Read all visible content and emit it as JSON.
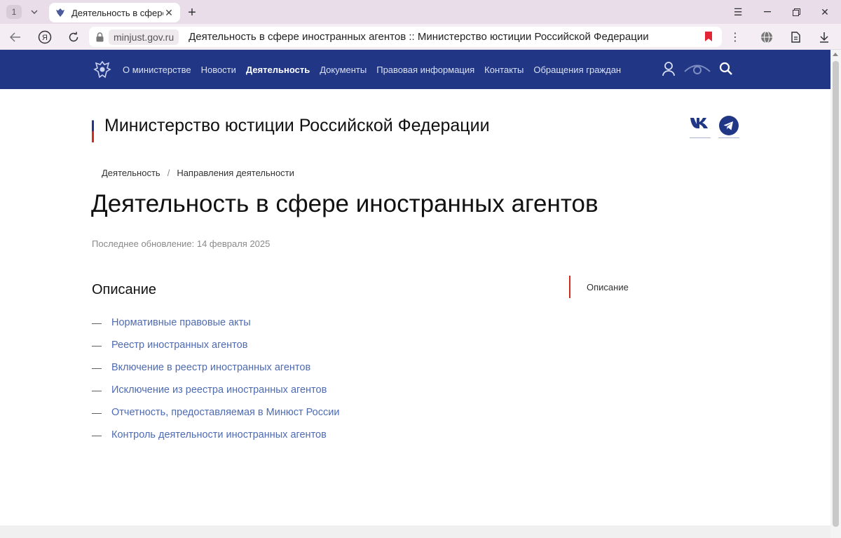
{
  "browser": {
    "tab_count": "1",
    "tab_title": "Деятельность в сфере",
    "domain": "minjust.gov.ru",
    "page_title": "Деятельность в сфере иностранных агентов :: Министерство юстиции Российской Федерации",
    "bookmark_color": "#e32636"
  },
  "site_nav": {
    "background": "#213785",
    "items": [
      {
        "label": "О министерстве"
      },
      {
        "label": "Новости"
      },
      {
        "label": "Деятельность"
      },
      {
        "label": "Документы"
      },
      {
        "label": "Правовая информация"
      },
      {
        "label": "Контакты"
      },
      {
        "label": "Обращения граждан"
      }
    ],
    "active_item": "Деятельность",
    "icons": [
      "user-icon",
      "eye-icon",
      "search-icon"
    ]
  },
  "header": {
    "ministry_title": "Министерство юстиции Российской Федерации",
    "social": [
      "vk-icon",
      "telegram-icon"
    ]
  },
  "breadcrumb": {
    "items": [
      "Деятельность",
      "Направления деятельности"
    ],
    "separator": "/"
  },
  "page": {
    "title": "Деятельность в сфере иностранных агентов",
    "updated": "Последнее обновление: 14 февраля 2025",
    "section_title": "Описание",
    "links": [
      "Нормативные правовые акты",
      "Реестр иностранных агентов",
      "Включение в реестр иностранных агентов",
      "Исключение из реестра иностранных агентов",
      "Отчетность, предоставляемая в Минюст России",
      "Контроль деятельности иностранных агентов"
    ],
    "link_color": "#4e6bb2",
    "dash": "—"
  },
  "toc": {
    "items": [
      "Описание"
    ],
    "accent": "#d52b1e"
  }
}
